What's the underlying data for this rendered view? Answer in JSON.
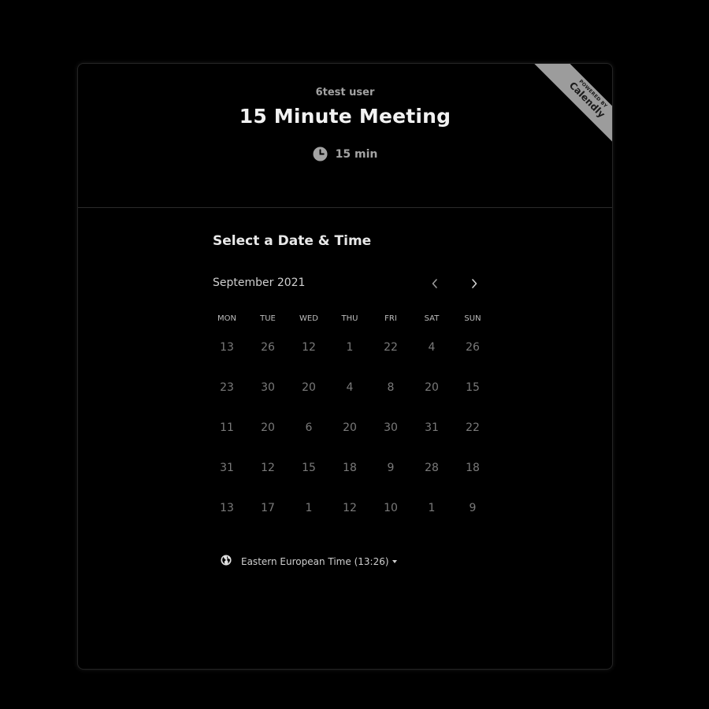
{
  "header": {
    "organizer": "6test user",
    "event_title": "15 Minute Meeting",
    "duration": "15 min"
  },
  "ribbon": {
    "small_text": "POWERED BY",
    "brand": "Calendly"
  },
  "scheduler": {
    "section_title": "Select a Date & Time",
    "month_label": "September 2021",
    "weekdays": [
      "MON",
      "TUE",
      "WED",
      "THU",
      "FRI",
      "SAT",
      "SUN"
    ],
    "days": [
      [
        "13",
        "26",
        "12",
        "1",
        "22",
        "4",
        "26"
      ],
      [
        "23",
        "30",
        "20",
        "4",
        "8",
        "20",
        "15"
      ],
      [
        "11",
        "20",
        "6",
        "20",
        "30",
        "31",
        "22"
      ],
      [
        "31",
        "12",
        "15",
        "18",
        "9",
        "28",
        "18"
      ],
      [
        "13",
        "17",
        "1",
        "12",
        "10",
        "1",
        "9"
      ]
    ],
    "timezone": "Eastern European Time (13:26)"
  },
  "icons": {
    "duration": "clock-icon",
    "prev": "chevron-left-icon",
    "next": "chevron-right-icon",
    "timezone": "globe-icon"
  },
  "colors": {
    "background": "#000000",
    "ribbon": "#9c9c9c",
    "muted_day": "#7a7a7a"
  }
}
